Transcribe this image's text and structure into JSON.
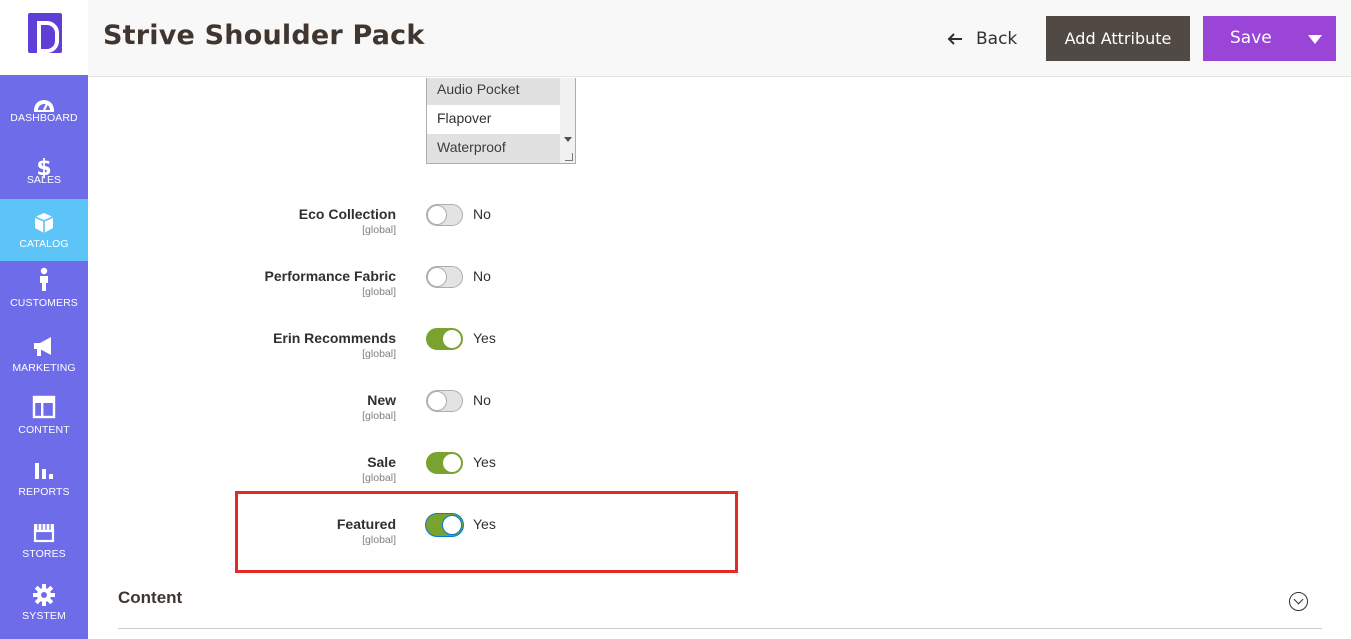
{
  "sidebar": {
    "items": [
      {
        "label": "DASHBOARD",
        "icon": "dashboard-icon"
      },
      {
        "label": "SALES",
        "icon": "dollar-icon"
      },
      {
        "label": "CATALOG",
        "icon": "box-icon"
      },
      {
        "label": "CUSTOMERS",
        "icon": "person-icon"
      },
      {
        "label": "MARKETING",
        "icon": "megaphone-icon"
      },
      {
        "label": "CONTENT",
        "icon": "layout-icon"
      },
      {
        "label": "REPORTS",
        "icon": "bar-chart-icon"
      },
      {
        "label": "STORES",
        "icon": "store-icon"
      },
      {
        "label": "SYSTEM",
        "icon": "gear-icon"
      }
    ],
    "active": "CATALOG"
  },
  "header": {
    "title": "Strive Shoulder Pack",
    "back_label": "Back",
    "add_attribute_label": "Add Attribute",
    "save_label": "Save"
  },
  "multiselect": {
    "options": [
      {
        "label": "Audio Pocket",
        "selected": true
      },
      {
        "label": "Flapover",
        "selected": false
      },
      {
        "label": "Waterproof",
        "selected": true
      }
    ]
  },
  "fields": [
    {
      "label": "Eco Collection",
      "scope": "[global]",
      "value": "No"
    },
    {
      "label": "Performance Fabric",
      "scope": "[global]",
      "value": "No"
    },
    {
      "label": "Erin Recommends",
      "scope": "[global]",
      "value": "Yes"
    },
    {
      "label": "New",
      "scope": "[global]",
      "value": "No"
    },
    {
      "label": "Sale",
      "scope": "[global]",
      "value": "Yes"
    },
    {
      "label": "Featured",
      "scope": "[global]",
      "value": "Yes"
    }
  ],
  "content_section": {
    "title": "Content"
  },
  "colors": {
    "sidebar_bg": "#6f6cea",
    "sidebar_active": "#5cc4f6",
    "toggle_on": "#79a22e",
    "save_button": "#9b44d8",
    "add_attribute_button": "#514943",
    "highlight": "#e02b27"
  }
}
